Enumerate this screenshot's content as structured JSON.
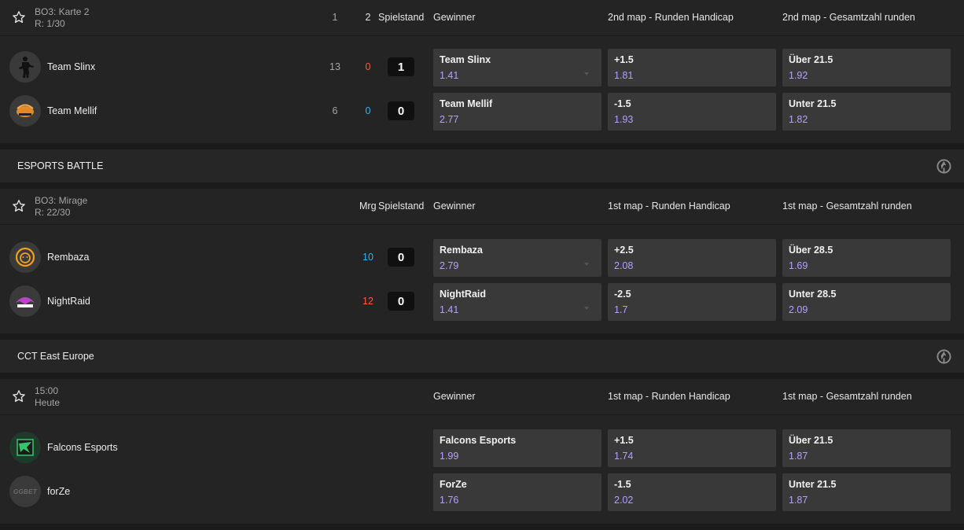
{
  "colors": {
    "accent_odds": "#b6a0ff",
    "score_red": "#ff5a3c",
    "score_blue": "#29b6f6"
  },
  "matches": [
    {
      "meta": {
        "line1": "BO3: Karte 2",
        "line2": "R: 1/30"
      },
      "header": {
        "maps_a": "1",
        "maps_b": "2",
        "score_label": "Spielstand",
        "winner": "Gewinner",
        "market2": "2nd map - Runden Handicap",
        "market3": "2nd map - Gesamtzahl runden"
      },
      "teams": [
        {
          "name": "Team Slinx",
          "map_score": "13",
          "round_score": "0",
          "series": "1",
          "logo": "soldier-icon"
        },
        {
          "name": "Team Mellif",
          "map_score": "6",
          "round_score": "0",
          "series": "0",
          "logo": "hornet-icon"
        }
      ],
      "odds": [
        [
          {
            "label": "Team Slinx",
            "value": "1.41"
          },
          {
            "label": "+1.5",
            "value": "1.81"
          },
          {
            "label": "Über 21.5",
            "value": "1.92"
          }
        ],
        [
          {
            "label": "Team Mellif",
            "value": "2.77"
          },
          {
            "label": "-1.5",
            "value": "1.93"
          },
          {
            "label": "Unter 21.5",
            "value": "1.82"
          }
        ]
      ]
    },
    {
      "league": "ESPORTS BATTLE",
      "meta": {
        "line1": "BO3: Mirage",
        "line2": "R: 22/30"
      },
      "header": {
        "mrg": "Mrg",
        "score_label": "Spielstand",
        "winner": "Gewinner",
        "market2": "1st map - Runden Handicap",
        "market3": "1st map - Gesamtzahl runden"
      },
      "teams": [
        {
          "name": "Rembaza",
          "round_score": "10",
          "series": "0",
          "logo": "lion-icon"
        },
        {
          "name": "NightRaid",
          "round_score": "12",
          "series": "0",
          "logo": "nightraid-icon"
        }
      ],
      "odds": [
        [
          {
            "label": "Rembaza",
            "value": "2.79"
          },
          {
            "label": "+2.5",
            "value": "2.08"
          },
          {
            "label": "Über 28.5",
            "value": "1.69"
          }
        ],
        [
          {
            "label": "NightRaid",
            "value": "1.41"
          },
          {
            "label": "-2.5",
            "value": "1.7"
          },
          {
            "label": "Unter 28.5",
            "value": "2.09"
          }
        ]
      ]
    },
    {
      "league": "CCT East Europe",
      "meta": {
        "line1": "15:00",
        "line2": "Heute"
      },
      "header": {
        "winner": "Gewinner",
        "market2": "1st map - Runden Handicap",
        "market3": "1st map - Gesamtzahl runden"
      },
      "teams": [
        {
          "name": "Falcons Esports",
          "logo": "falcon-icon"
        },
        {
          "name": "forZe",
          "logo": "ggbet-icon",
          "logo_text": "GGBET"
        }
      ],
      "odds": [
        [
          {
            "label": "Falcons Esports",
            "value": "1.99"
          },
          {
            "label": "+1.5",
            "value": "1.74"
          },
          {
            "label": "Über 21.5",
            "value": "1.87"
          }
        ],
        [
          {
            "label": "ForZe",
            "value": "1.76"
          },
          {
            "label": "-1.5",
            "value": "2.02"
          },
          {
            "label": "Unter 21.5",
            "value": "1.87"
          }
        ]
      ]
    }
  ]
}
